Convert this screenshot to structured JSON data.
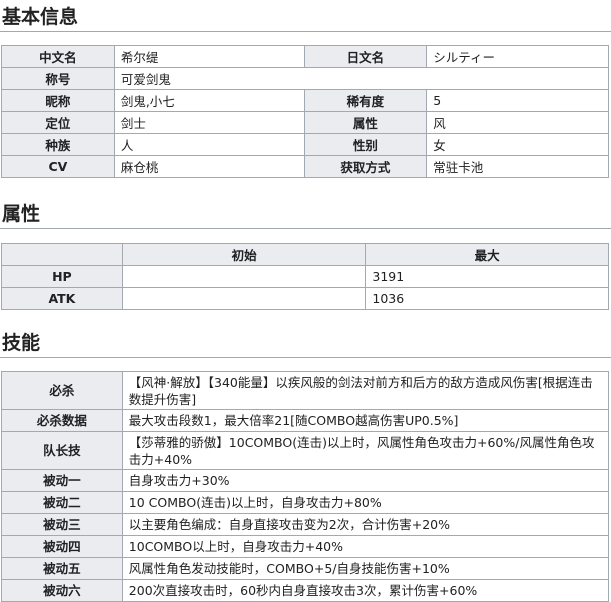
{
  "sections": {
    "basic": "基本信息",
    "attributes": "属性",
    "skills": "技能"
  },
  "basic": {
    "rows": [
      {
        "label1": "中文名",
        "value1": "希尔缇",
        "label2": "日文名",
        "value2": "シルティー"
      },
      {
        "label1": "称号",
        "value1": "可爱剑鬼"
      },
      {
        "label1": "昵称",
        "value1": "剑鬼,小七",
        "label2": "稀有度",
        "value2": "5"
      },
      {
        "label1": "定位",
        "value1": "剑士",
        "label2": "属性",
        "value2": "风"
      },
      {
        "label1": "种族",
        "value1": "人",
        "label2": "性别",
        "value2": "女"
      },
      {
        "label1": "CV",
        "value1": "麻仓桃",
        "label2": "获取方式",
        "value2": "常驻卡池"
      }
    ]
  },
  "attributes": {
    "headers": [
      "初始",
      "最大"
    ],
    "rows": [
      {
        "label": "HP",
        "initial": "",
        "max": "3191"
      },
      {
        "label": "ATK",
        "initial": "",
        "max": "1036"
      }
    ]
  },
  "skills": {
    "rows": [
      {
        "label": "必杀",
        "text": "【风神·解放】【340能量】以疾风般的剑法对前方和后方的敌方造成风伤害[根据连击数提升伤害]"
      },
      {
        "label": "必杀数据",
        "text": "最大攻击段数1，最大倍率21[随COMBO越高伤害UP0.5%]"
      },
      {
        "label": "队长技",
        "text": "【莎蒂雅的骄傲】10COMBO(连击)以上时，风属性角色攻击力+60%/风属性角色攻击力+40%"
      },
      {
        "label": "被动一",
        "text": "自身攻击力+30%"
      },
      {
        "label": "被动二",
        "text": "10 COMBO(连击)以上时，自身攻击力+80%"
      },
      {
        "label": "被动三",
        "text": "以主要角色编成：自身直接攻击变为2次，合计伤害+20%"
      },
      {
        "label": "被动四",
        "text": "10COMBO以上时，自身攻击力+40%"
      },
      {
        "label": "被动五",
        "text": "风属性角色发动技能时，COMBO+5/自身技能伤害+10%"
      },
      {
        "label": "被动六",
        "text": "200次直接攻击时，60秒内自身直接攻击3次，累计伤害+60%"
      }
    ]
  }
}
